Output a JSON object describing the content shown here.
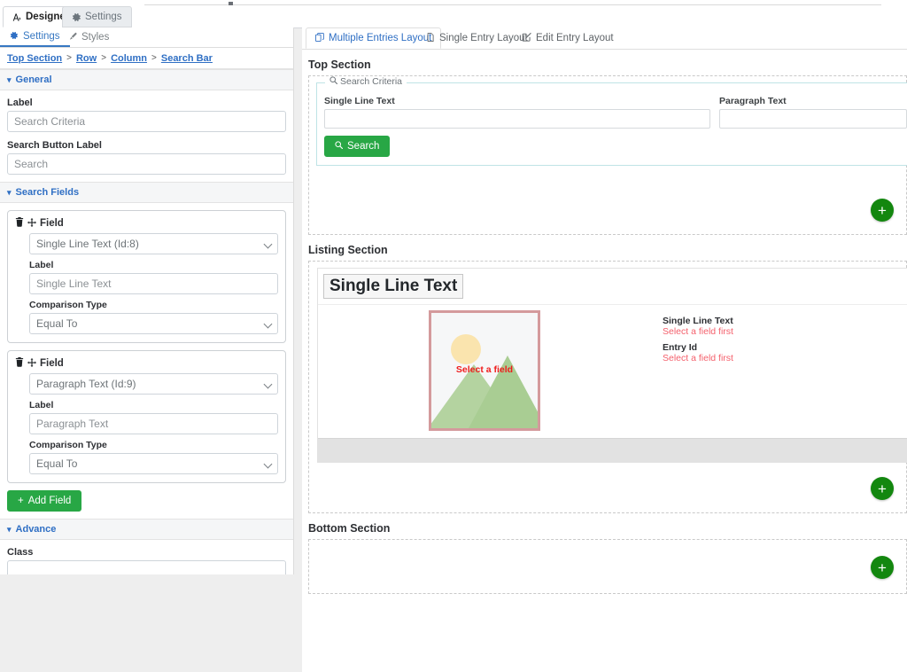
{
  "outer_tabs": [
    {
      "label": "Designer",
      "icon": "designer-icon",
      "active": true
    },
    {
      "label": "Settings",
      "icon": "gear-icon",
      "active": false
    }
  ],
  "panel": {
    "tabs": [
      {
        "label": "Settings",
        "icon": "gear-icon",
        "active": true
      },
      {
        "label": "Styles",
        "icon": "brush-icon",
        "active": false
      }
    ],
    "breadcrumb": [
      "Top Section",
      "Row",
      "Column",
      "Search Bar"
    ],
    "breadcrumb_separator": ">",
    "sections": {
      "general": {
        "title": "General",
        "label_field_label": "Label",
        "label_field_value": "Search Criteria",
        "button_field_label": "Search Button Label",
        "button_field_value": "Search"
      },
      "search_fields": {
        "title": "Search Fields",
        "field_heading": "Field",
        "label_caption": "Label",
        "comparison_caption": "Comparison Type",
        "items": [
          {
            "field": "Single Line Text (Id:8)",
            "label": "Single Line Text",
            "comparison": "Equal To"
          },
          {
            "field": "Paragraph Text (Id:9)",
            "label": "Paragraph Text",
            "comparison": "Equal To"
          }
        ],
        "add_field_label": "Add Field"
      },
      "advance": {
        "title": "Advance",
        "class_label": "Class",
        "class_value": ""
      }
    }
  },
  "canvas": {
    "tabs": [
      {
        "label": "Multiple Entries Layout",
        "icon": "copy-icon",
        "active": true
      },
      {
        "label": "Single Entry Layout",
        "icon": "file-icon",
        "active": false
      },
      {
        "label": "Edit Entry Layout",
        "icon": "edit-square-icon",
        "active": false
      }
    ],
    "top_section": {
      "title": "Top Section",
      "legend": "Search Criteria",
      "fields": [
        {
          "label": "Single Line Text",
          "value": ""
        },
        {
          "label": "Paragraph Text",
          "value": ""
        }
      ],
      "search_button": "Search",
      "add_label": "+"
    },
    "listing_section": {
      "title": "Listing Section",
      "heading": "Single Line Text",
      "image_placeholder_text": "Select a field",
      "meta": [
        {
          "title": "Single Line Text",
          "status": "Select a field first"
        },
        {
          "title": "Entry Id",
          "status": "Select a field first"
        }
      ],
      "add_label": "+"
    },
    "bottom_section": {
      "title": "Bottom Section",
      "add_label": "+"
    }
  },
  "colors": {
    "green": "#28a745",
    "plus_green": "#13870f",
    "link_blue": "#2f6fc4",
    "danger_red": "#ef1c1c",
    "status_red": "#f4606c",
    "placeholder_border": "#d49a9c"
  }
}
